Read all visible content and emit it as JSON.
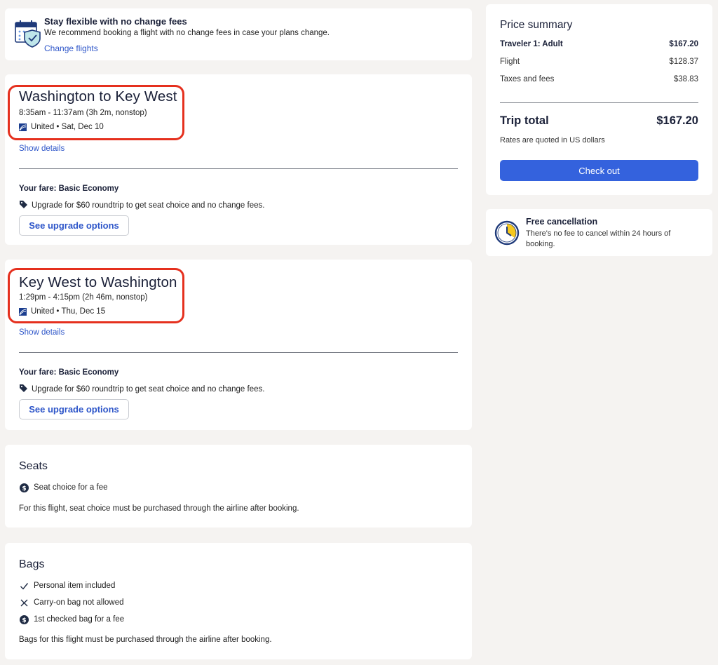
{
  "banner": {
    "title": "Stay flexible with no change fees",
    "text": "We recommend booking a flight with no change fees in case your plans change.",
    "link": "Change flights",
    "icon": "calendar-shield-icon"
  },
  "flights": [
    {
      "title": "Washington to Key West",
      "time": "8:35am - 11:37am (3h 2m, nonstop)",
      "airline": "United • Sat, Dec 10",
      "details_link": "Show details",
      "fare": "Your fare: Basic Economy",
      "upgrade_text": "Upgrade for $60 roundtrip to get seat choice and no change fees.",
      "upgrade_button": "See upgrade options"
    },
    {
      "title": "Key West to Washington",
      "time": "1:29pm - 4:15pm (2h 46m, nonstop)",
      "airline": "United • Thu, Dec 15",
      "details_link": "Show details",
      "fare": "Your fare: Basic Economy",
      "upgrade_text": "Upgrade for $60 roundtrip to get seat choice and no change fees.",
      "upgrade_button": "See upgrade options"
    }
  ],
  "seats": {
    "title": "Seats",
    "item": "Seat choice for a fee",
    "note": "For this flight, seat choice must be purchased through the airline after booking."
  },
  "bags": {
    "title": "Bags",
    "items": [
      {
        "label": "Personal item included",
        "icon": "check-icon"
      },
      {
        "label": "Carry-on bag not allowed",
        "icon": "x-icon"
      },
      {
        "label": "1st checked bag for a fee",
        "icon": "dollar-icon"
      }
    ],
    "note": "Bags for this flight must be purchased through the airline after booking."
  },
  "price_summary": {
    "title": "Price summary",
    "traveler_label": "Traveler 1: Adult",
    "traveler_value": "$167.20",
    "flight_label": "Flight",
    "flight_value": "$128.37",
    "taxes_label": "Taxes and fees",
    "taxes_value": "$38.83",
    "total_label": "Trip total",
    "total_value": "$167.20",
    "note": "Rates are quoted in US dollars",
    "checkout": "Check out"
  },
  "cancellation": {
    "title": "Free cancellation",
    "text": "There's no fee to cancel within 24 hours of booking.",
    "icon": "clock-icon"
  },
  "colors": {
    "accent": "#3462dd",
    "link": "#2e56c9",
    "highlight": "#e5301e",
    "background": "#f5f3f1"
  }
}
